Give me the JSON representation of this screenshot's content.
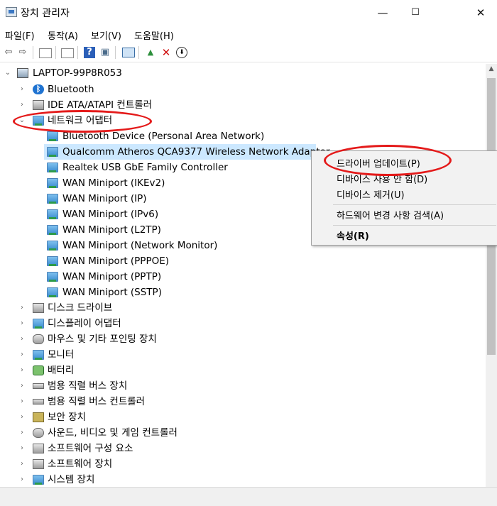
{
  "window": {
    "title": "장치 관리자",
    "minimize": "—",
    "maximize": "☐",
    "close": "✕"
  },
  "menu": [
    "파일(F)",
    "동작(A)",
    "보기(V)",
    "도움말(H)"
  ],
  "toolbar": {
    "back": "⇦",
    "forward": "⇨",
    "help": "?",
    "scan": "▣",
    "enable": "▲",
    "remove": "✕",
    "download": "⬇"
  },
  "tree": {
    "root": "LAPTOP-99P8R053",
    "categories_before": [
      {
        "label": "Bluetooth"
      },
      {
        "label": "IDE ATA/ATAPI 컨트롤러"
      }
    ],
    "network": {
      "label": "네트워크 어댑터",
      "children": [
        "Bluetooth Device (Personal Area Network)",
        "Qualcomm Atheros QCA9377 Wireless Network Adapter",
        "Realtek USB GbE Family Controller",
        "WAN Miniport (IKEv2)",
        "WAN Miniport (IP)",
        "WAN Miniport (IPv6)",
        "WAN Miniport (L2TP)",
        "WAN Miniport (Network Monitor)",
        "WAN Miniport (PPPOE)",
        "WAN Miniport (PPTP)",
        "WAN Miniport (SSTP)"
      ]
    },
    "categories_after": [
      "디스크 드라이브",
      "디스플레이 어댑터",
      "마우스 및 기타 포인팅 장치",
      "모니터",
      "배터리",
      "범용 직렬 버스 장치",
      "범용 직렬 버스 컨트롤러",
      "보안 장치",
      "사운드, 비디오 및 게임 컨트롤러",
      "소프트웨어 구성 요소",
      "소프트웨어 장치",
      "시스템 장치"
    ]
  },
  "context_menu": {
    "update_driver": "드라이버 업데이트(P)",
    "disable_device": "디바이스 사용 안 함(D)",
    "uninstall_device": "디바이스 제거(U)",
    "scan_hardware": "하드웨어 변경 사항 검색(A)",
    "properties": "속성(R)"
  },
  "colors": {
    "annotation": "#e41a1a",
    "selection": "#cce8ff"
  }
}
